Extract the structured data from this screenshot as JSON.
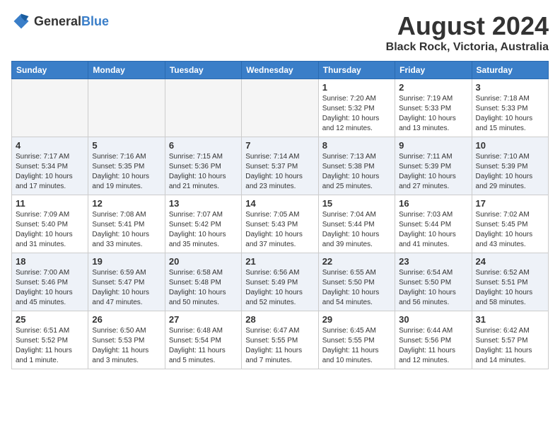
{
  "logo": {
    "general": "General",
    "blue": "Blue"
  },
  "title": "August 2024",
  "subtitle": "Black Rock, Victoria, Australia",
  "days_of_week": [
    "Sunday",
    "Monday",
    "Tuesday",
    "Wednesday",
    "Thursday",
    "Friday",
    "Saturday"
  ],
  "weeks": [
    [
      {
        "day": "",
        "info": ""
      },
      {
        "day": "",
        "info": ""
      },
      {
        "day": "",
        "info": ""
      },
      {
        "day": "",
        "info": ""
      },
      {
        "day": "1",
        "info": "Sunrise: 7:20 AM\nSunset: 5:32 PM\nDaylight: 10 hours\nand 12 minutes."
      },
      {
        "day": "2",
        "info": "Sunrise: 7:19 AM\nSunset: 5:33 PM\nDaylight: 10 hours\nand 13 minutes."
      },
      {
        "day": "3",
        "info": "Sunrise: 7:18 AM\nSunset: 5:33 PM\nDaylight: 10 hours\nand 15 minutes."
      }
    ],
    [
      {
        "day": "4",
        "info": "Sunrise: 7:17 AM\nSunset: 5:34 PM\nDaylight: 10 hours\nand 17 minutes."
      },
      {
        "day": "5",
        "info": "Sunrise: 7:16 AM\nSunset: 5:35 PM\nDaylight: 10 hours\nand 19 minutes."
      },
      {
        "day": "6",
        "info": "Sunrise: 7:15 AM\nSunset: 5:36 PM\nDaylight: 10 hours\nand 21 minutes."
      },
      {
        "day": "7",
        "info": "Sunrise: 7:14 AM\nSunset: 5:37 PM\nDaylight: 10 hours\nand 23 minutes."
      },
      {
        "day": "8",
        "info": "Sunrise: 7:13 AM\nSunset: 5:38 PM\nDaylight: 10 hours\nand 25 minutes."
      },
      {
        "day": "9",
        "info": "Sunrise: 7:11 AM\nSunset: 5:39 PM\nDaylight: 10 hours\nand 27 minutes."
      },
      {
        "day": "10",
        "info": "Sunrise: 7:10 AM\nSunset: 5:39 PM\nDaylight: 10 hours\nand 29 minutes."
      }
    ],
    [
      {
        "day": "11",
        "info": "Sunrise: 7:09 AM\nSunset: 5:40 PM\nDaylight: 10 hours\nand 31 minutes."
      },
      {
        "day": "12",
        "info": "Sunrise: 7:08 AM\nSunset: 5:41 PM\nDaylight: 10 hours\nand 33 minutes."
      },
      {
        "day": "13",
        "info": "Sunrise: 7:07 AM\nSunset: 5:42 PM\nDaylight: 10 hours\nand 35 minutes."
      },
      {
        "day": "14",
        "info": "Sunrise: 7:05 AM\nSunset: 5:43 PM\nDaylight: 10 hours\nand 37 minutes."
      },
      {
        "day": "15",
        "info": "Sunrise: 7:04 AM\nSunset: 5:44 PM\nDaylight: 10 hours\nand 39 minutes."
      },
      {
        "day": "16",
        "info": "Sunrise: 7:03 AM\nSunset: 5:44 PM\nDaylight: 10 hours\nand 41 minutes."
      },
      {
        "day": "17",
        "info": "Sunrise: 7:02 AM\nSunset: 5:45 PM\nDaylight: 10 hours\nand 43 minutes."
      }
    ],
    [
      {
        "day": "18",
        "info": "Sunrise: 7:00 AM\nSunset: 5:46 PM\nDaylight: 10 hours\nand 45 minutes."
      },
      {
        "day": "19",
        "info": "Sunrise: 6:59 AM\nSunset: 5:47 PM\nDaylight: 10 hours\nand 47 minutes."
      },
      {
        "day": "20",
        "info": "Sunrise: 6:58 AM\nSunset: 5:48 PM\nDaylight: 10 hours\nand 50 minutes."
      },
      {
        "day": "21",
        "info": "Sunrise: 6:56 AM\nSunset: 5:49 PM\nDaylight: 10 hours\nand 52 minutes."
      },
      {
        "day": "22",
        "info": "Sunrise: 6:55 AM\nSunset: 5:50 PM\nDaylight: 10 hours\nand 54 minutes."
      },
      {
        "day": "23",
        "info": "Sunrise: 6:54 AM\nSunset: 5:50 PM\nDaylight: 10 hours\nand 56 minutes."
      },
      {
        "day": "24",
        "info": "Sunrise: 6:52 AM\nSunset: 5:51 PM\nDaylight: 10 hours\nand 58 minutes."
      }
    ],
    [
      {
        "day": "25",
        "info": "Sunrise: 6:51 AM\nSunset: 5:52 PM\nDaylight: 11 hours\nand 1 minute."
      },
      {
        "day": "26",
        "info": "Sunrise: 6:50 AM\nSunset: 5:53 PM\nDaylight: 11 hours\nand 3 minutes."
      },
      {
        "day": "27",
        "info": "Sunrise: 6:48 AM\nSunset: 5:54 PM\nDaylight: 11 hours\nand 5 minutes."
      },
      {
        "day": "28",
        "info": "Sunrise: 6:47 AM\nSunset: 5:55 PM\nDaylight: 11 hours\nand 7 minutes."
      },
      {
        "day": "29",
        "info": "Sunrise: 6:45 AM\nSunset: 5:55 PM\nDaylight: 11 hours\nand 10 minutes."
      },
      {
        "day": "30",
        "info": "Sunrise: 6:44 AM\nSunset: 5:56 PM\nDaylight: 11 hours\nand 12 minutes."
      },
      {
        "day": "31",
        "info": "Sunrise: 6:42 AM\nSunset: 5:57 PM\nDaylight: 11 hours\nand 14 minutes."
      }
    ]
  ]
}
